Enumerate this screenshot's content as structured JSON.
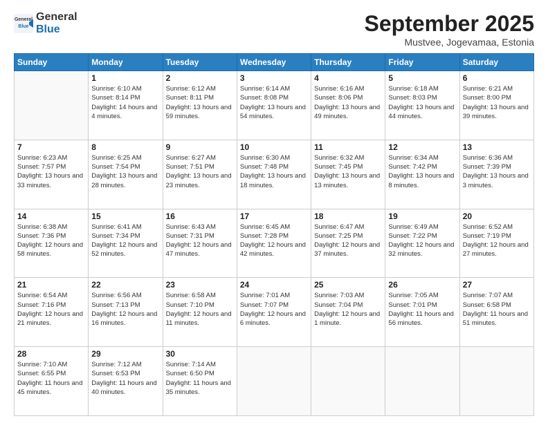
{
  "logo": {
    "general": "General",
    "blue": "Blue"
  },
  "title": "September 2025",
  "subtitle": "Mustvee, Jogevamaa, Estonia",
  "weekdays": [
    "Sunday",
    "Monday",
    "Tuesday",
    "Wednesday",
    "Thursday",
    "Friday",
    "Saturday"
  ],
  "weeks": [
    [
      {
        "day": "",
        "sunrise": "",
        "sunset": "",
        "daylight": ""
      },
      {
        "day": "1",
        "sunrise": "Sunrise: 6:10 AM",
        "sunset": "Sunset: 8:14 PM",
        "daylight": "Daylight: 14 hours and 4 minutes."
      },
      {
        "day": "2",
        "sunrise": "Sunrise: 6:12 AM",
        "sunset": "Sunset: 8:11 PM",
        "daylight": "Daylight: 13 hours and 59 minutes."
      },
      {
        "day": "3",
        "sunrise": "Sunrise: 6:14 AM",
        "sunset": "Sunset: 8:08 PM",
        "daylight": "Daylight: 13 hours and 54 minutes."
      },
      {
        "day": "4",
        "sunrise": "Sunrise: 6:16 AM",
        "sunset": "Sunset: 8:06 PM",
        "daylight": "Daylight: 13 hours and 49 minutes."
      },
      {
        "day": "5",
        "sunrise": "Sunrise: 6:18 AM",
        "sunset": "Sunset: 8:03 PM",
        "daylight": "Daylight: 13 hours and 44 minutes."
      },
      {
        "day": "6",
        "sunrise": "Sunrise: 6:21 AM",
        "sunset": "Sunset: 8:00 PM",
        "daylight": "Daylight: 13 hours and 39 minutes."
      }
    ],
    [
      {
        "day": "7",
        "sunrise": "Sunrise: 6:23 AM",
        "sunset": "Sunset: 7:57 PM",
        "daylight": "Daylight: 13 hours and 33 minutes."
      },
      {
        "day": "8",
        "sunrise": "Sunrise: 6:25 AM",
        "sunset": "Sunset: 7:54 PM",
        "daylight": "Daylight: 13 hours and 28 minutes."
      },
      {
        "day": "9",
        "sunrise": "Sunrise: 6:27 AM",
        "sunset": "Sunset: 7:51 PM",
        "daylight": "Daylight: 13 hours and 23 minutes."
      },
      {
        "day": "10",
        "sunrise": "Sunrise: 6:30 AM",
        "sunset": "Sunset: 7:48 PM",
        "daylight": "Daylight: 13 hours and 18 minutes."
      },
      {
        "day": "11",
        "sunrise": "Sunrise: 6:32 AM",
        "sunset": "Sunset: 7:45 PM",
        "daylight": "Daylight: 13 hours and 13 minutes."
      },
      {
        "day": "12",
        "sunrise": "Sunrise: 6:34 AM",
        "sunset": "Sunset: 7:42 PM",
        "daylight": "Daylight: 13 hours and 8 minutes."
      },
      {
        "day": "13",
        "sunrise": "Sunrise: 6:36 AM",
        "sunset": "Sunset: 7:39 PM",
        "daylight": "Daylight: 13 hours and 3 minutes."
      }
    ],
    [
      {
        "day": "14",
        "sunrise": "Sunrise: 6:38 AM",
        "sunset": "Sunset: 7:36 PM",
        "daylight": "Daylight: 12 hours and 58 minutes."
      },
      {
        "day": "15",
        "sunrise": "Sunrise: 6:41 AM",
        "sunset": "Sunset: 7:34 PM",
        "daylight": "Daylight: 12 hours and 52 minutes."
      },
      {
        "day": "16",
        "sunrise": "Sunrise: 6:43 AM",
        "sunset": "Sunset: 7:31 PM",
        "daylight": "Daylight: 12 hours and 47 minutes."
      },
      {
        "day": "17",
        "sunrise": "Sunrise: 6:45 AM",
        "sunset": "Sunset: 7:28 PM",
        "daylight": "Daylight: 12 hours and 42 minutes."
      },
      {
        "day": "18",
        "sunrise": "Sunrise: 6:47 AM",
        "sunset": "Sunset: 7:25 PM",
        "daylight": "Daylight: 12 hours and 37 minutes."
      },
      {
        "day": "19",
        "sunrise": "Sunrise: 6:49 AM",
        "sunset": "Sunset: 7:22 PM",
        "daylight": "Daylight: 12 hours and 32 minutes."
      },
      {
        "day": "20",
        "sunrise": "Sunrise: 6:52 AM",
        "sunset": "Sunset: 7:19 PM",
        "daylight": "Daylight: 12 hours and 27 minutes."
      }
    ],
    [
      {
        "day": "21",
        "sunrise": "Sunrise: 6:54 AM",
        "sunset": "Sunset: 7:16 PM",
        "daylight": "Daylight: 12 hours and 21 minutes."
      },
      {
        "day": "22",
        "sunrise": "Sunrise: 6:56 AM",
        "sunset": "Sunset: 7:13 PM",
        "daylight": "Daylight: 12 hours and 16 minutes."
      },
      {
        "day": "23",
        "sunrise": "Sunrise: 6:58 AM",
        "sunset": "Sunset: 7:10 PM",
        "daylight": "Daylight: 12 hours and 11 minutes."
      },
      {
        "day": "24",
        "sunrise": "Sunrise: 7:01 AM",
        "sunset": "Sunset: 7:07 PM",
        "daylight": "Daylight: 12 hours and 6 minutes."
      },
      {
        "day": "25",
        "sunrise": "Sunrise: 7:03 AM",
        "sunset": "Sunset: 7:04 PM",
        "daylight": "Daylight: 12 hours and 1 minute."
      },
      {
        "day": "26",
        "sunrise": "Sunrise: 7:05 AM",
        "sunset": "Sunset: 7:01 PM",
        "daylight": "Daylight: 11 hours and 56 minutes."
      },
      {
        "day": "27",
        "sunrise": "Sunrise: 7:07 AM",
        "sunset": "Sunset: 6:58 PM",
        "daylight": "Daylight: 11 hours and 51 minutes."
      }
    ],
    [
      {
        "day": "28",
        "sunrise": "Sunrise: 7:10 AM",
        "sunset": "Sunset: 6:55 PM",
        "daylight": "Daylight: 11 hours and 45 minutes."
      },
      {
        "day": "29",
        "sunrise": "Sunrise: 7:12 AM",
        "sunset": "Sunset: 6:53 PM",
        "daylight": "Daylight: 11 hours and 40 minutes."
      },
      {
        "day": "30",
        "sunrise": "Sunrise: 7:14 AM",
        "sunset": "Sunset: 6:50 PM",
        "daylight": "Daylight: 11 hours and 35 minutes."
      },
      {
        "day": "",
        "sunrise": "",
        "sunset": "",
        "daylight": ""
      },
      {
        "day": "",
        "sunrise": "",
        "sunset": "",
        "daylight": ""
      },
      {
        "day": "",
        "sunrise": "",
        "sunset": "",
        "daylight": ""
      },
      {
        "day": "",
        "sunrise": "",
        "sunset": "",
        "daylight": ""
      }
    ]
  ]
}
